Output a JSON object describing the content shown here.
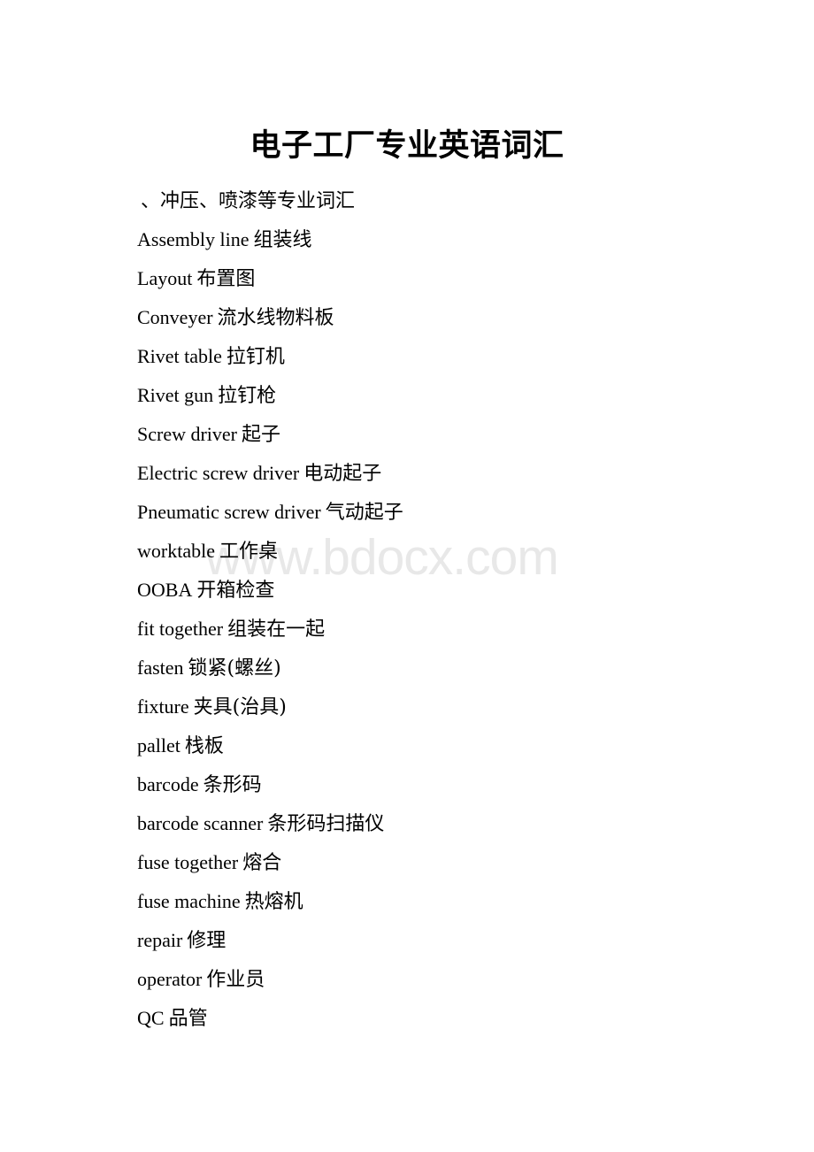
{
  "document": {
    "title": "电子工厂专业英语词汇",
    "watermark": "www.bdocx.com",
    "watermark_color": "#e8e8e8",
    "text_color": "#000000",
    "background_color": "#ffffff",
    "section_heading": "、冲压、喷漆等专业词汇",
    "entries": [
      {
        "term": "Assembly line",
        "translation": "组装线"
      },
      {
        "term": "Layout",
        "translation": "布置图"
      },
      {
        "term": "Conveyer",
        "translation": "流水线物料板"
      },
      {
        "term": "Rivet table",
        "translation": "拉钉机"
      },
      {
        "term": "Rivet gun",
        "translation": "拉钉枪"
      },
      {
        "term": "Screw driver",
        "translation": "起子"
      },
      {
        "term": "Electric screw driver",
        "translation": "电动起子"
      },
      {
        "term": "Pneumatic screw driver",
        "translation": "气动起子"
      },
      {
        "term": "worktable",
        "translation": "工作桌"
      },
      {
        "term": "OOBA",
        "translation": "开箱检查"
      },
      {
        "term": "fit together",
        "translation": "组装在一起"
      },
      {
        "term": "fasten",
        "translation": "锁紧(螺丝)"
      },
      {
        "term": "fixture",
        "translation": "夹具(治具)"
      },
      {
        "term": "pallet",
        "translation": "栈板"
      },
      {
        "term": "barcode",
        "translation": "条形码"
      },
      {
        "term": "barcode scanner",
        "translation": "条形码扫描仪"
      },
      {
        "term": "fuse together",
        "translation": "熔合"
      },
      {
        "term": "fuse machine",
        "translation": "热熔机"
      },
      {
        "term": "repair",
        "translation": "修理"
      },
      {
        "term": "operator",
        "translation": "作业员"
      },
      {
        "term": "QC",
        "translation": "品管"
      }
    ]
  }
}
